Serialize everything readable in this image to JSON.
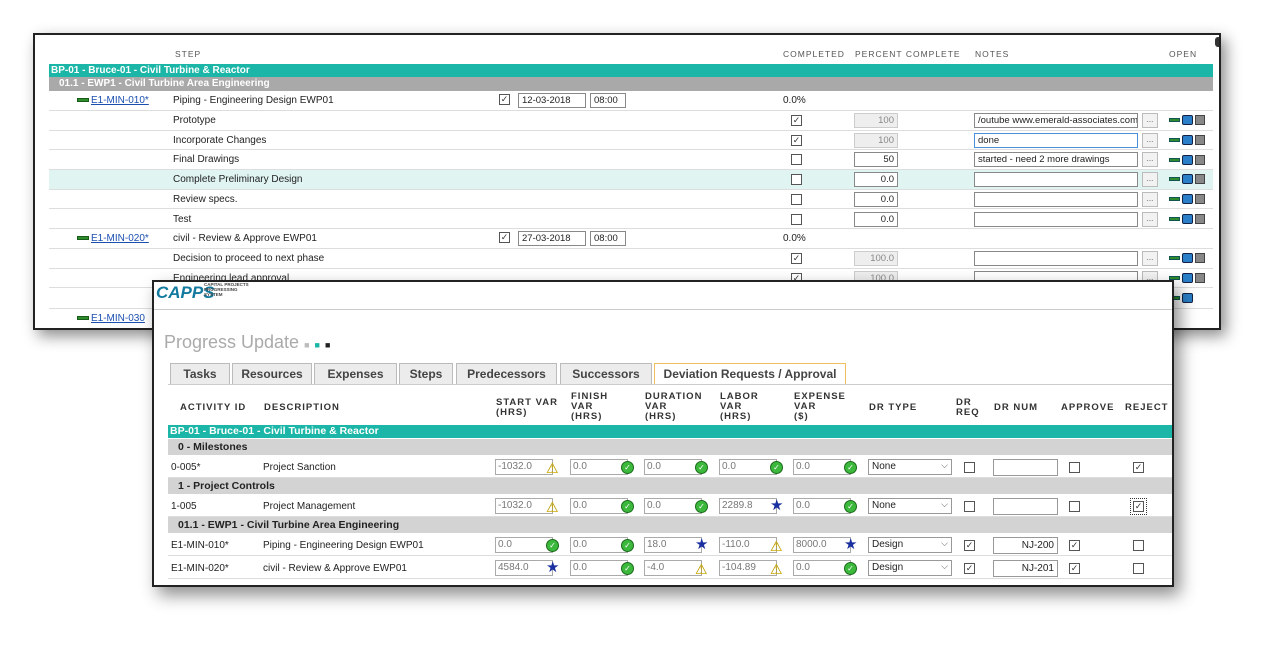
{
  "steps_window": {
    "columns": {
      "step": "STEP",
      "completed": "COMPLETED",
      "percent": "PERCENT COMPLETE",
      "notes": "NOTES",
      "open": "OPEN"
    },
    "band_project": "BP-01 - Bruce-01 - Civil Turbine & Reactor",
    "band_ewp": "01.1 - EWP1 - Civil Turbine Area Engineering",
    "act1": {
      "id": "E1-MIN-010*",
      "desc": "Piping - Engineering Design EWP01",
      "date": "12-03-2018",
      "time": "08:00",
      "pct": "0.0%"
    },
    "act1_steps": [
      {
        "name": "Prototype",
        "checked": true,
        "pct": "100",
        "disabled": true,
        "note": "/outube www.emerald-associates.com"
      },
      {
        "name": "Incorporate Changes",
        "checked": true,
        "pct": "100",
        "disabled": true,
        "note": "done"
      },
      {
        "name": "Final Drawings",
        "checked": false,
        "pct": "50",
        "disabled": false,
        "note": "started - need 2 more drawings"
      },
      {
        "name": "Complete Preliminary Design",
        "checked": false,
        "pct": "0.0",
        "disabled": false,
        "note": ""
      },
      {
        "name": "Review specs.",
        "checked": false,
        "pct": "0.0",
        "disabled": false,
        "note": ""
      },
      {
        "name": "Test",
        "checked": false,
        "pct": "0.0",
        "disabled": false,
        "note": ""
      }
    ],
    "act2": {
      "id": "E1-MIN-020*",
      "desc": "civil - Review & Approve EWP01",
      "date": "27-03-2018",
      "time": "08:00",
      "pct": "0.0%"
    },
    "act2_steps": [
      {
        "name": "Decision to proceed to next phase",
        "checked": true,
        "pct": "100.0",
        "disabled": true,
        "note": ""
      },
      {
        "name": "Engineering lead approval",
        "checked": true,
        "pct": "100.0",
        "disabled": true,
        "note": ""
      }
    ],
    "act3": {
      "id": "E1-MIN-030"
    }
  },
  "progress_window": {
    "logo": "CAPPS",
    "logo_sub1": "CAPITAL PROJECTS",
    "logo_sub2": "PROGRESSING",
    "logo_sub3": "SYSTEM",
    "title": "Progress Update",
    "tabs": [
      "Tasks",
      "Resources",
      "Expenses",
      "Steps",
      "Predecessors",
      "Successors",
      "Deviation Requests / Approval"
    ],
    "headers": {
      "activity_id": "ACTIVITY ID",
      "description": "DESCRIPTION",
      "start_var": "START VAR",
      "start_var2": "(HRS)",
      "finish_var": "FINISH",
      "finish_var2": "VAR",
      "finish_var3": "(HRS)",
      "duration_var": "DURATION",
      "duration_var2": "VAR",
      "duration_var3": "(HRS)",
      "labor_var": "LABOR",
      "labor_var2": "VAR",
      "labor_var3": "(HRS)",
      "expense_var": "EXPENSE",
      "expense_var2": "VAR",
      "expense_var3": "($)",
      "dr_type": "DR TYPE",
      "dr_req": "DR",
      "dr_req2": "REQ",
      "dr_num": "DR NUM",
      "approve": "APPROVE",
      "reject": "REJECT"
    },
    "band_project": "BP-01 - Bruce-01 - Civil Turbine & Reactor",
    "groups": {
      "g1": "0 - Milestones",
      "g2": "1 - Project Controls",
      "g3": "01.1 - EWP1 - Civil Turbine Area Engineering"
    },
    "rows": [
      {
        "id": "0-005*",
        "desc": "Project Sanction",
        "start": "-1032.0",
        "finish": "0.0",
        "duration": "0.0",
        "labor": "0.0",
        "expense": "0.0",
        "dr_type": "None",
        "dr_req": false,
        "dr_num": "",
        "approve": false,
        "reject": true
      },
      {
        "id": "1-005",
        "desc": "Project Management",
        "start": "-1032.0",
        "finish": "0.0",
        "duration": "0.0",
        "labor": "2289.8",
        "expense": "0.0",
        "dr_type": "None",
        "dr_req": false,
        "dr_num": "",
        "approve": false,
        "reject": true
      },
      {
        "id": "E1-MIN-010*",
        "desc": "Piping - Engineering Design EWP01",
        "start": "0.0",
        "finish": "0.0",
        "duration": "18.0",
        "labor": "-110.0",
        "expense": "8000.0",
        "dr_type": "Design",
        "dr_req": true,
        "dr_num": "NJ-200",
        "approve": true,
        "reject": false
      },
      {
        "id": "E1-MIN-020*",
        "desc": "civil - Review & Approve EWP01",
        "start": "4584.0",
        "finish": "0.0",
        "duration": "-4.0",
        "labor": "-104.89",
        "expense": "0.0",
        "dr_type": "Design",
        "dr_req": true,
        "dr_num": "NJ-201",
        "approve": true,
        "reject": false
      }
    ]
  }
}
